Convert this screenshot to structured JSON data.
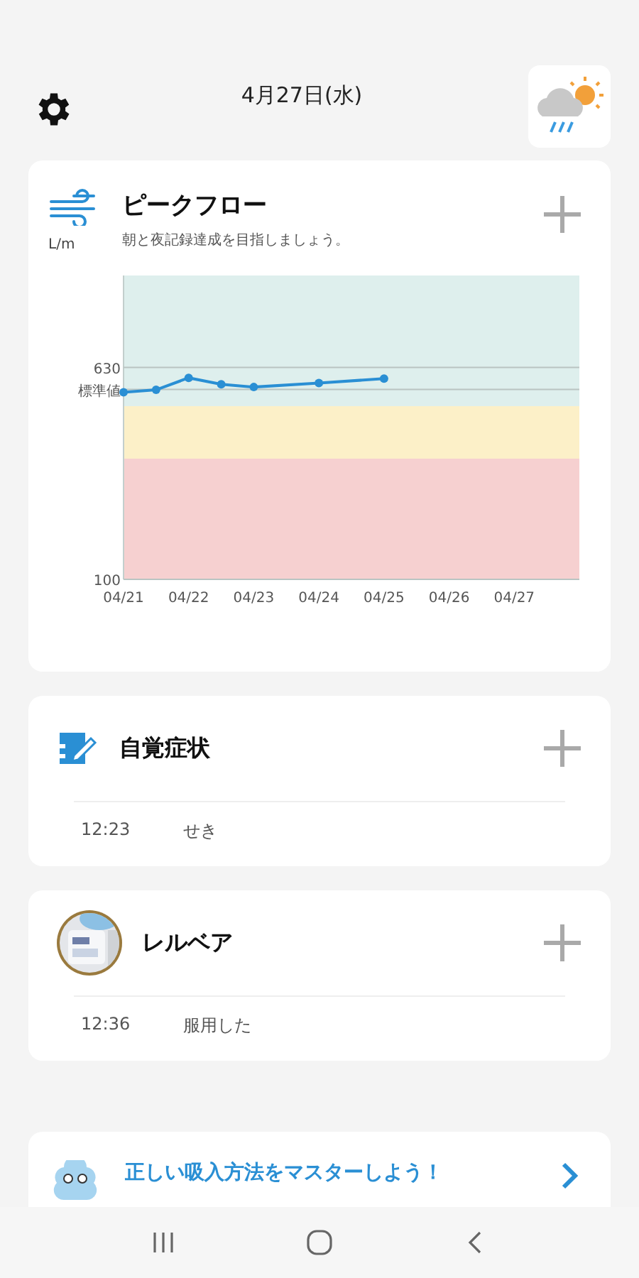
{
  "header": {
    "date": "4月27日(水)"
  },
  "peak_flow": {
    "title": "ピークフロー",
    "unit": "L/m",
    "subtitle": "朝と夜記録達成を目指しましょう。",
    "chart_data": {
      "type": "line",
      "categories": [
        "04/21",
        null,
        "04/22",
        null,
        "04/23",
        null,
        "04/24",
        null,
        "04/25",
        null,
        "04/26",
        null,
        "04/27",
        null
      ],
      "ylim": [
        100,
        860
      ],
      "series": [
        {
          "color": "#2a8fd4",
          "marker": "circle",
          "values": [
            568,
            574,
            604,
            588,
            581,
            null,
            591,
            null,
            602,
            null,
            null,
            null,
            null,
            null
          ]
        }
      ],
      "yticks": [
        100,
        630,
        {
          "value": 575,
          "label": "標準値"
        }
      ]
    }
  },
  "records": [
    {
      "kind": "symptom",
      "title": "自覚症状",
      "entries": [
        {
          "time": "12:23",
          "text": "せき"
        }
      ]
    },
    {
      "kind": "medicine",
      "title": "レルベア",
      "entries": [
        {
          "time": "12:36",
          "text": "服用した"
        }
      ]
    }
  ],
  "banner": {
    "title": "正しい吸入方法をマスターしよう！"
  }
}
